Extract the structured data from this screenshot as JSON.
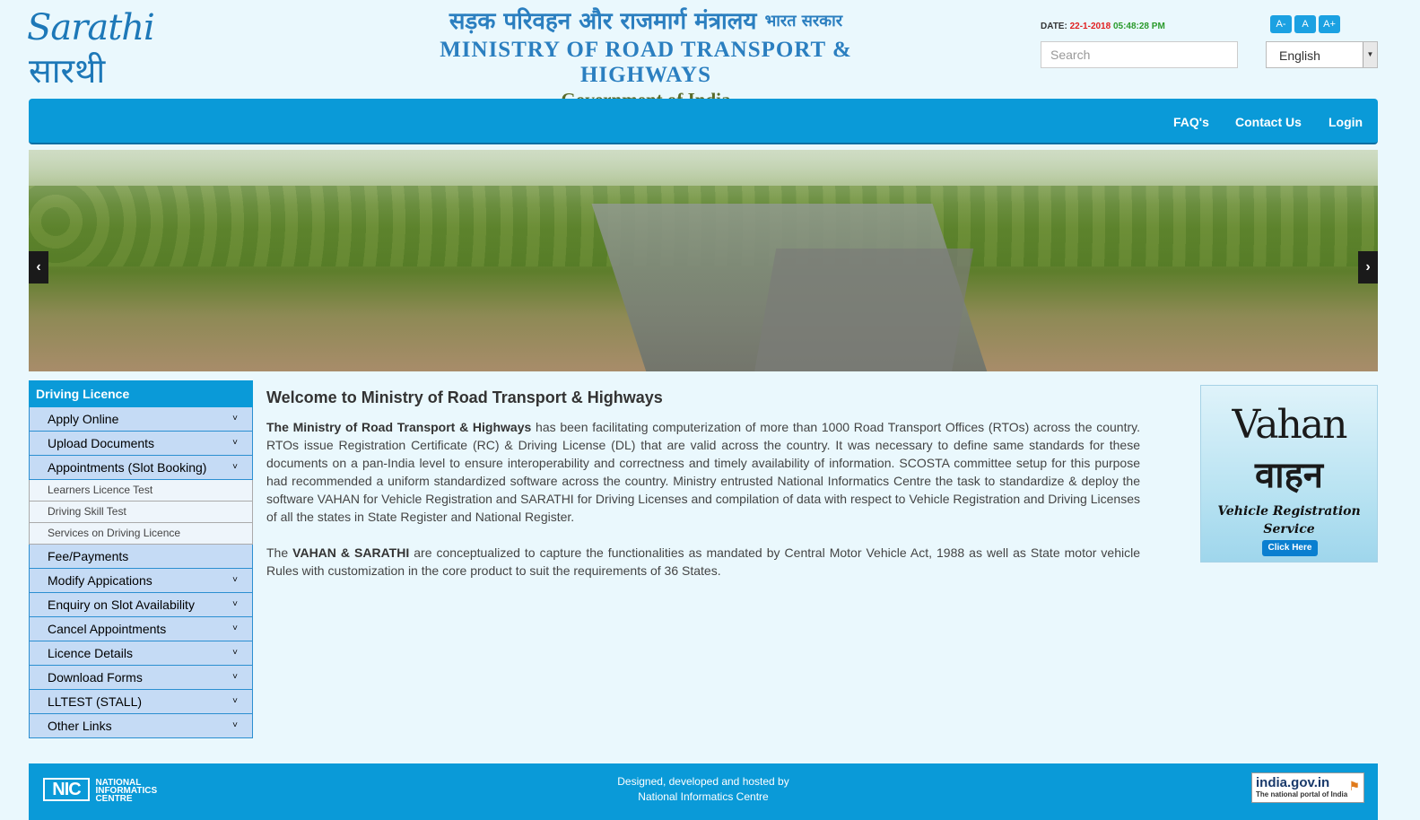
{
  "header": {
    "logo_en": "Sarathi",
    "logo_hi": "सारथी",
    "ministry_hindi": "सड़क परिवहन और राजमार्ग मंत्रालय",
    "ministry_hindi_sub": "भारत सरकार",
    "ministry_en": "MINISTRY OF ROAD TRANSPORT & HIGHWAYS",
    "government": "Government of India",
    "date_label": "DATE:",
    "date": "22-1-2018",
    "time": "05:48:28 PM",
    "font_buttons": [
      "A-",
      "A",
      "A+"
    ],
    "search_placeholder": "Search",
    "language": "English"
  },
  "navbar": {
    "links": [
      "FAQ's",
      "Contact Us",
      "Login"
    ]
  },
  "carousel": {
    "prev": "‹",
    "next": "›"
  },
  "sidebar": {
    "title": "Driving Licence",
    "items": [
      {
        "label": "Apply Online",
        "expandable": true
      },
      {
        "label": "Upload Documents",
        "expandable": true
      },
      {
        "label": "Appointments (Slot Booking)",
        "expandable": true
      },
      {
        "label": "Fee/Payments",
        "expandable": false
      },
      {
        "label": "Modify Appications",
        "expandable": true
      },
      {
        "label": "Enquiry on Slot Availability",
        "expandable": true
      },
      {
        "label": "Cancel Appointments",
        "expandable": true
      },
      {
        "label": "Licence Details",
        "expandable": true
      },
      {
        "label": "Download Forms",
        "expandable": true
      },
      {
        "label": "LLTEST (STALL)",
        "expandable": true
      },
      {
        "label": "Other Links",
        "expandable": true
      }
    ],
    "subitems": [
      "Learners Licence Test",
      "Driving Skill Test",
      "Services on Driving Licence"
    ]
  },
  "content": {
    "title": "Welcome to Ministry of Road Transport & Highways",
    "p1_bold": "The Ministry of Road Transport & Highways",
    "p1_rest": " has been facilitating computerization of more than 1000 Road Transport Offices (RTOs) across the country. RTOs issue Registration Certificate (RC) & Driving License (DL) that are valid across the country. It was necessary to define same standards for these documents on a pan-India level to ensure interoperability and correctness and timely availability of information. SCOSTA committee setup for this purpose had recommended a uniform standardized software across the country. Ministry entrusted National Informatics Centre the task to standardize & deploy the software VAHAN for Vehicle Registration and SARATHI for Driving Licenses and compilation of data with respect to Vehicle Registration and Driving Licenses of all the states in State Register and National Register.",
    "p2_pre": "The ",
    "p2_bold": "VAHAN & SARATHI",
    "p2_rest": " are conceptualized to capture the functionalities as mandated by Central Motor Vehicle Act, 1988 as well as State motor vehicle Rules with customization in the core product to suit the requirements of 36 States."
  },
  "vahan_ad": {
    "title_en": "Vahan",
    "title_hi": "वाहन",
    "subtitle_1": "Vehicle Registration",
    "subtitle_2": "Service",
    "button": "Click Here"
  },
  "footer": {
    "nic_logo": "NIC",
    "nic_line1": "NATIONAL",
    "nic_line2": "INFORMATICS",
    "nic_line3": "CENTRE",
    "credit_1": "Designed, developed and hosted by",
    "credit_2": "National Informatics Centre",
    "indiagov_1": "india.gov.in",
    "indiagov_2": "The national portal of India"
  },
  "colors": {
    "primary": "#0a9ad8",
    "menu_bg": "#c5dbf5",
    "page_bg": "#eaf8fd"
  }
}
